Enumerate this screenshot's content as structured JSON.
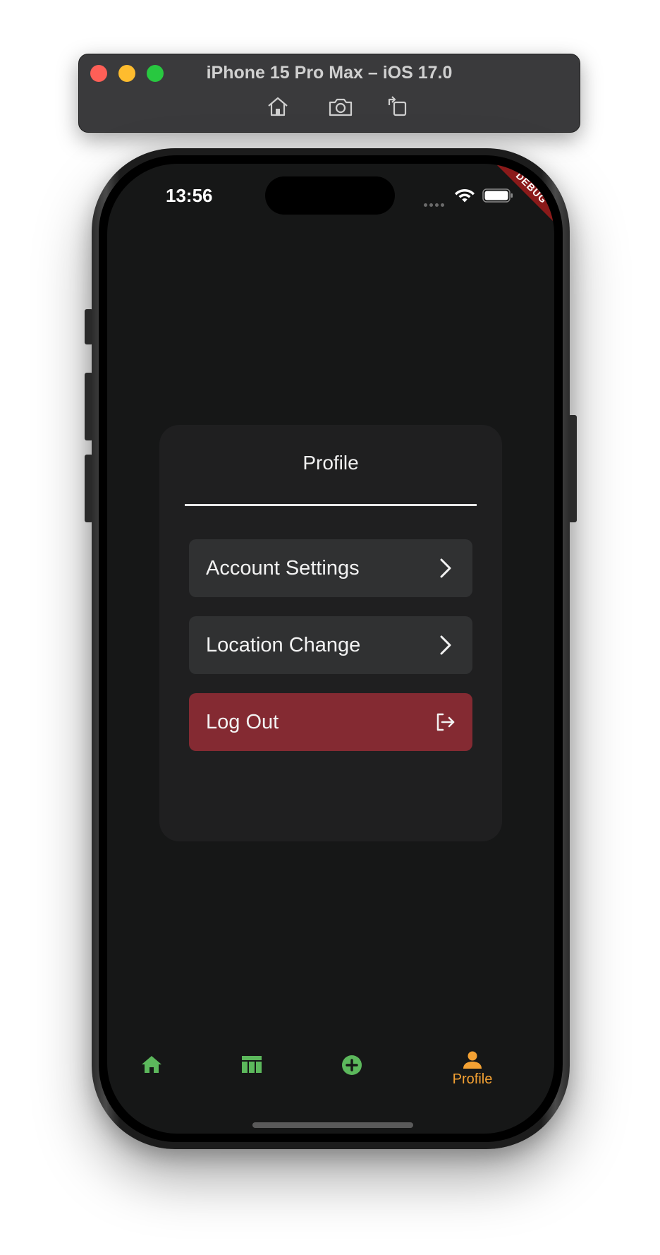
{
  "simulator": {
    "title": "iPhone 15 Pro Max – iOS 17.0",
    "tools": [
      "home-icon",
      "screenshot-icon",
      "rotate-icon"
    ]
  },
  "status_bar": {
    "time": "13:56",
    "debug_banner": "DEBUG"
  },
  "profile": {
    "title": "Profile",
    "items": [
      {
        "label": "Account Settings",
        "icon": "chevron-right-icon"
      },
      {
        "label": "Location Change",
        "icon": "chevron-right-icon"
      },
      {
        "label": "Log Out",
        "icon": "logout-icon",
        "color": "#842a32"
      }
    ]
  },
  "bottom_nav": {
    "items": [
      {
        "icon": "home-icon",
        "label": "",
        "active": false
      },
      {
        "icon": "table-icon",
        "label": "",
        "active": false
      },
      {
        "icon": "add-circle-icon",
        "label": "",
        "active": false
      },
      {
        "icon": "person-icon",
        "label": "Profile",
        "active": true
      }
    ],
    "active_color": "#f3a133",
    "inactive_color": "#5cb85c"
  },
  "colors": {
    "background": "#161717",
    "card": "#1f1f20",
    "button": "#303132",
    "logout": "#842a32"
  }
}
